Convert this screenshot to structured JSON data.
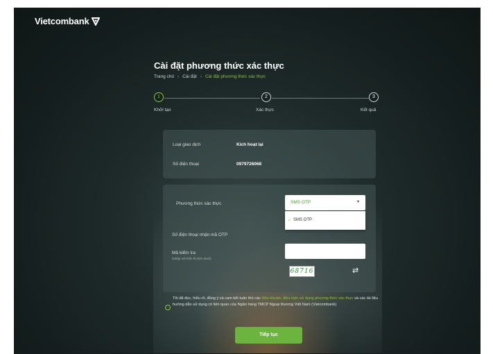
{
  "brand": {
    "name": "Vietcombank",
    "accent": "#8cc63f",
    "logo_icon": "vcb-shield-icon"
  },
  "page": {
    "title": "Cài đặt phương thức xác thực"
  },
  "breadcrumb": {
    "items": [
      "Trang chủ",
      "Cài đặt",
      "Cài đặt phương thức xác thực"
    ],
    "separator": "›"
  },
  "stepper": {
    "steps": [
      {
        "number": "1",
        "label": "Khởi tạo",
        "active": true
      },
      {
        "number": "2",
        "label": "Xác thực",
        "active": false
      },
      {
        "number": "3",
        "label": "Kết quả",
        "active": false
      }
    ]
  },
  "transaction": {
    "type_label": "Loại giao dịch",
    "type_value": "Kích hoạt lại",
    "phone_label": "Số điện thoại",
    "phone_value": "0979726068"
  },
  "form": {
    "method_label": "Phương thức xác thực",
    "method_selected": "SMS OTP",
    "method_options": [
      "SMS OTP"
    ],
    "otp_phone_label": "Số điện thoại nhận mã OTP",
    "captcha_label": "Mã kiểm tra",
    "captcha_hint": "(Nhập mã hiển thị bên dưới)",
    "captcha_input_value": "",
    "captcha_code": "68716"
  },
  "terms": {
    "text_before": "Tôi đã đọc, hiểu rõ, đồng ý và cam kết tuân thủ các ",
    "link": "điều khoản, điều kiện sử dụng phương thức xác thực",
    "text_after": " và các tài liệu hướng dẫn sử dụng có liên quan của Ngân hàng TMCP Ngoại thương Việt Nam (Vietcombank)"
  },
  "actions": {
    "continue_label": "Tiếp tục"
  }
}
